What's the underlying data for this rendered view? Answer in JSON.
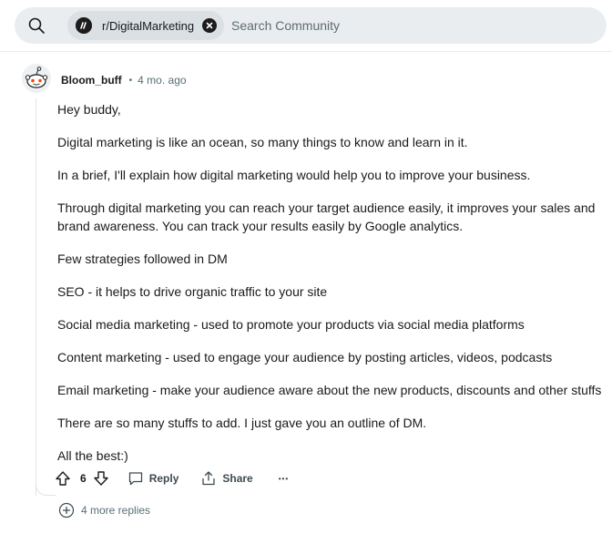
{
  "search": {
    "community_chip": "r/DigitalMarketing",
    "placeholder": "Search Community",
    "icons": [
      "search-icon",
      "subreddit-icon",
      "close-icon"
    ]
  },
  "comment": {
    "username": "Bloom_buff",
    "separator": "•",
    "timestamp": "4 mo. ago",
    "paragraphs": [
      "Hey buddy,",
      "Digital marketing is like an ocean, so many things to know and learn in it.",
      "In a brief, I'll explain how digital marketing would help you to improve your business.",
      "Through digital marketing you can reach your target audience easily, it improves your sales and brand awareness. You can track your results easily by Google analytics.",
      "Few strategies followed in DM",
      "SEO - it helps to drive organic traffic to your site",
      "Social media marketing - used to promote your products via social media platforms",
      "Content marketing - used to engage your audience by posting articles, videos, podcasts",
      "Email marketing - make your audience aware about the new products, discounts and other stuffs",
      "There are so many stuffs to add. I just gave you an outline of DM.",
      "All the best:)"
    ],
    "score": "6",
    "reply_label": "Reply",
    "share_label": "Share",
    "more_label": "•••",
    "more_replies_label": "4 more replies"
  }
}
